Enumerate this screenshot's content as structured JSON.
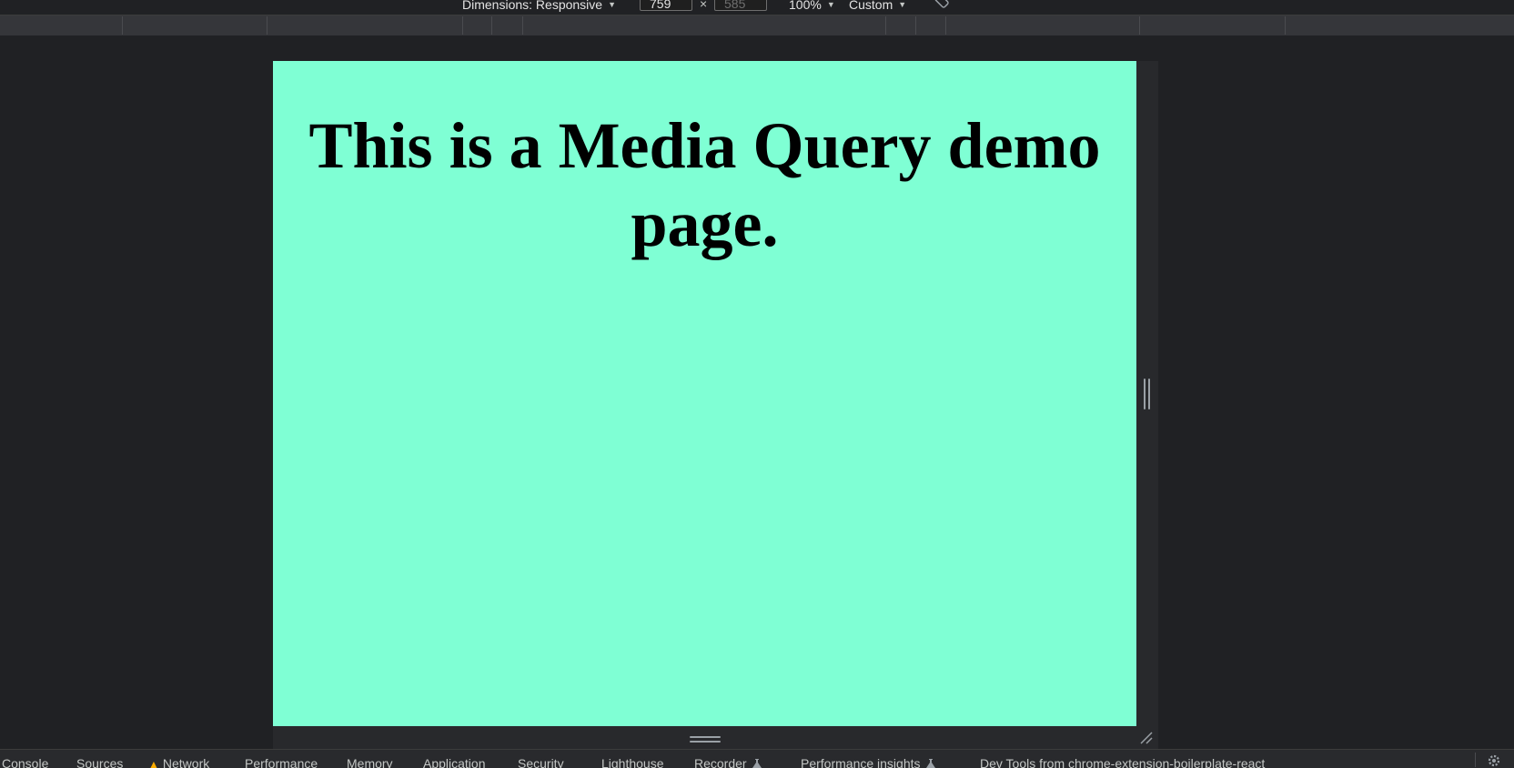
{
  "toolbar": {
    "dimensions_label": "Dimensions: Responsive",
    "width_value": "759",
    "height_value": "585",
    "times_symbol": "×",
    "zoom_label": "100%",
    "throttle_label": "Custom"
  },
  "page": {
    "heading": "This is a Media Query demo page.",
    "background_color": "#7fffd4"
  },
  "devtools_tabs": [
    {
      "label": "Console"
    },
    {
      "label": "Sources"
    },
    {
      "label": "Network",
      "warning": true
    },
    {
      "label": "Performance"
    },
    {
      "label": "Memory"
    },
    {
      "label": "Application"
    },
    {
      "label": "Security"
    },
    {
      "label": "Lighthouse"
    },
    {
      "label": "Recorder",
      "experimental": true
    },
    {
      "label": "Performance insights",
      "experimental": true
    },
    {
      "label": "Dev Tools from chrome-extension-boilerplate-react"
    }
  ],
  "icons": {
    "dropdown": "chevron-down-icon",
    "rotate": "rotate-device-icon",
    "warning": "warning-icon",
    "experimental": "flask-icon",
    "settings": "gear-icon",
    "resize": "resize-handle-icon"
  }
}
